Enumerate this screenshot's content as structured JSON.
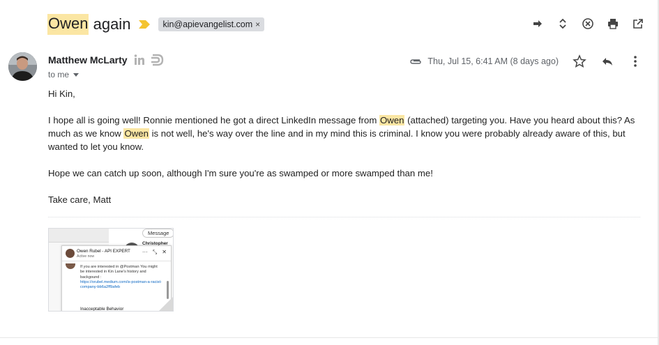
{
  "subject": {
    "highlight": "Owen",
    "rest": " again",
    "label": "kin@apievangelist.com",
    "label_remove": "×"
  },
  "top_actions": [
    "forward-all-icon",
    "expand-collapse-icon",
    "cancel-icon",
    "print-icon",
    "open-in-new-window-icon"
  ],
  "sender": {
    "name": "Matthew McLarty",
    "recipient": "to me"
  },
  "meta": {
    "date": "Thu, Jul 15, 6:41 AM (8 days ago)"
  },
  "body": {
    "greeting": "Hi Kin,",
    "p1_a": "I hope all is going well! Ronnie mentioned he got a direct LinkedIn message from ",
    "p1_hl1": "Owen",
    "p1_b": " (attached) targeting you. Have you heard about this? As much as we know ",
    "p1_hl2": "Owen",
    "p1_c": " is not well, he's way over the line and in my mind this is criminal. I know you were probably already aware of this, but wanted to let you know.",
    "p2": "Hope we can catch up soon, although I'm sure you're as swamped or more swamped than me!",
    "signoff": "Take care, Matt"
  },
  "attachment": {
    "message_btn": "Message",
    "side_name": "Christopher Al",
    "chat_name": "Owen Rubel - API EXPERT",
    "chat_status": "Active now",
    "chat_ctrls": [
      "···",
      "⤡",
      "✕"
    ],
    "chat_text": "If you are interested in @Postman You might be interested in Kin Lane's history and backgound :",
    "chat_link": "https://orubel.medium.com/is-postman-a-racist-company-bb6a2ff9afeb",
    "chat_footer": "Inacceptable Behavior"
  },
  "colors": {
    "highlight": "#fbe6a3",
    "chip": "#dadce0",
    "importance": "#f4c430"
  }
}
